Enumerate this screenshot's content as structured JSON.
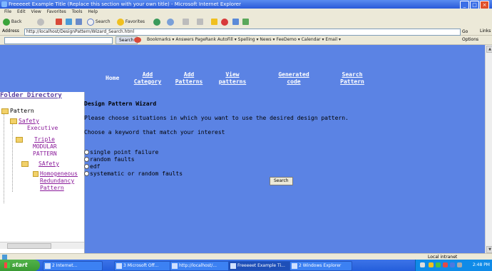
{
  "window": {
    "title": "Freeeeet Example Title (Replace this section with your own title) - Microsoft Internet Explorer",
    "min_label": "_",
    "max_label": "□",
    "close_label": "×"
  },
  "menubar": {
    "items": [
      "File",
      "Edit",
      "View",
      "Favorites",
      "Tools",
      "Help"
    ]
  },
  "toolbar": {
    "back_label": "Back",
    "search_label": "Search",
    "favorites_label": "Favorites"
  },
  "address": {
    "label": "Address",
    "url": "http://localhost/DesignPattern/Wizard_Search.html",
    "go_label": "Go",
    "links_label": "Links"
  },
  "google": {
    "search_btn": "Search",
    "items": "Bookmarks ▾  Answers  PageRank  AutoFill ▾  Spelling ▾  News ▾  FeeDemo ▾  Calendar ▾  Email ▾",
    "options_label": "Options"
  },
  "nav": {
    "home": "Home",
    "add_category": [
      "Add",
      "Category"
    ],
    "add_patterns": [
      "Add",
      "Patterns"
    ],
    "view_patterns": [
      "View",
      "patterns"
    ],
    "generated_code": [
      "Generated",
      "code"
    ],
    "search_pattern": [
      "Search",
      "Pattern"
    ]
  },
  "folder": {
    "title": "Folder Directory",
    "root": "Pattern",
    "safety": "Safety",
    "executive": "Executive",
    "triple": "Triple",
    "modular": "MODULAR",
    "pattern": "PATTERN",
    "sensor": "SAfety",
    "homogeneous": "Homogeneous",
    "redundancy": "Redundancy",
    "pattern2": "Pattern"
  },
  "wizard": {
    "title": "Design Pattern Wizard",
    "instruction1": "Please choose situations in which you want to use the desired design pattern.",
    "instruction2": "Choose a keyword that match your interest",
    "options": [
      "single point failure",
      "random faults",
      "edf",
      "systematic or random faults"
    ],
    "search_button": "Search"
  },
  "statusbar": {
    "zone": "Local intranet"
  },
  "taskbar": {
    "start": "start",
    "tasks": [
      "2 Internet...",
      "3 Microsoft Off...",
      "http://localhost/...",
      "Freeeeet Example Ti...",
      "2 Windows Explorer"
    ],
    "clock": "2:48 PM"
  },
  "colors": {
    "content_bg": "#5b83e4",
    "link_purple": "#8a1a9a",
    "titlebar": "#2a5ad8"
  }
}
